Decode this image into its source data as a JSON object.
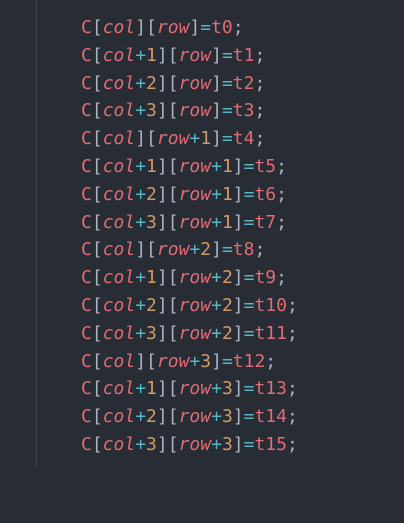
{
  "code_lines": [
    {
      "arr": "C",
      "col": "col",
      "col_off": "",
      "row": "row",
      "row_off": "",
      "target": "t0",
      "semi": ";"
    },
    {
      "arr": "C",
      "col": "col",
      "col_off": "1",
      "row": "row",
      "row_off": "",
      "target": "t1",
      "semi": ";"
    },
    {
      "arr": "C",
      "col": "col",
      "col_off": "2",
      "row": "row",
      "row_off": "",
      "target": "t2",
      "semi": ";"
    },
    {
      "arr": "C",
      "col": "col",
      "col_off": "3",
      "row": "row",
      "row_off": "",
      "target": "t3",
      "semi": ";"
    },
    {
      "arr": "C",
      "col": "col",
      "col_off": "",
      "row": "row",
      "row_off": "1",
      "target": "t4",
      "semi": ";"
    },
    {
      "arr": "C",
      "col": "col",
      "col_off": "1",
      "row": "row",
      "row_off": "1",
      "target": "t5",
      "semi": ";"
    },
    {
      "arr": "C",
      "col": "col",
      "col_off": "2",
      "row": "row",
      "row_off": "1",
      "target": "t6",
      "semi": ";"
    },
    {
      "arr": "C",
      "col": "col",
      "col_off": "3",
      "row": "row",
      "row_off": "1",
      "target": "t7",
      "semi": ";"
    },
    {
      "arr": "C",
      "col": "col",
      "col_off": "",
      "row": "row",
      "row_off": "2",
      "target": "t8",
      "semi": ";"
    },
    {
      "arr": "C",
      "col": "col",
      "col_off": "1",
      "row": "row",
      "row_off": "2",
      "target": "t9",
      "semi": ";"
    },
    {
      "arr": "C",
      "col": "col",
      "col_off": "2",
      "row": "row",
      "row_off": "2",
      "target": "t10",
      "semi": ";"
    },
    {
      "arr": "C",
      "col": "col",
      "col_off": "3",
      "row": "row",
      "row_off": "2",
      "target": "t11",
      "semi": ";"
    },
    {
      "arr": "C",
      "col": "col",
      "col_off": "",
      "row": "row",
      "row_off": "3",
      "target": "t12",
      "semi": ";"
    },
    {
      "arr": "C",
      "col": "col",
      "col_off": "1",
      "row": "row",
      "row_off": "3",
      "target": "t13",
      "semi": ";"
    },
    {
      "arr": "C",
      "col": "col",
      "col_off": "2",
      "row": "row",
      "row_off": "3",
      "target": "t14",
      "semi": ";"
    },
    {
      "arr": "C",
      "col": "col",
      "col_off": "3",
      "row": "row",
      "row_off": "3",
      "target": "t15",
      "semi": ";"
    }
  ],
  "theme": {
    "background": "#282c34",
    "identifier": "#e06c75",
    "punctuation": "#abb2bf",
    "operator": "#56b6c2",
    "number": "#d19a66"
  }
}
